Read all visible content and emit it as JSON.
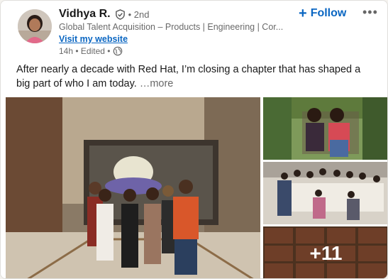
{
  "author": {
    "name": "Vidhya R.",
    "degree": "• 2nd",
    "headline": "Global Talent Acquisition – Products | Engineering | Cor...",
    "website": "Visit my website",
    "time": "14h • Edited •"
  },
  "actions": {
    "follow_label": "Follow"
  },
  "post": {
    "text": "After nearly a decade with Red Hat, I’m closing a chapter that has shaped a big part of who I am today.",
    "see_more": "…more"
  },
  "gallery": {
    "more_count": "+11"
  },
  "colors": {
    "accent": "#0a66c2",
    "muted": "#00000099"
  }
}
